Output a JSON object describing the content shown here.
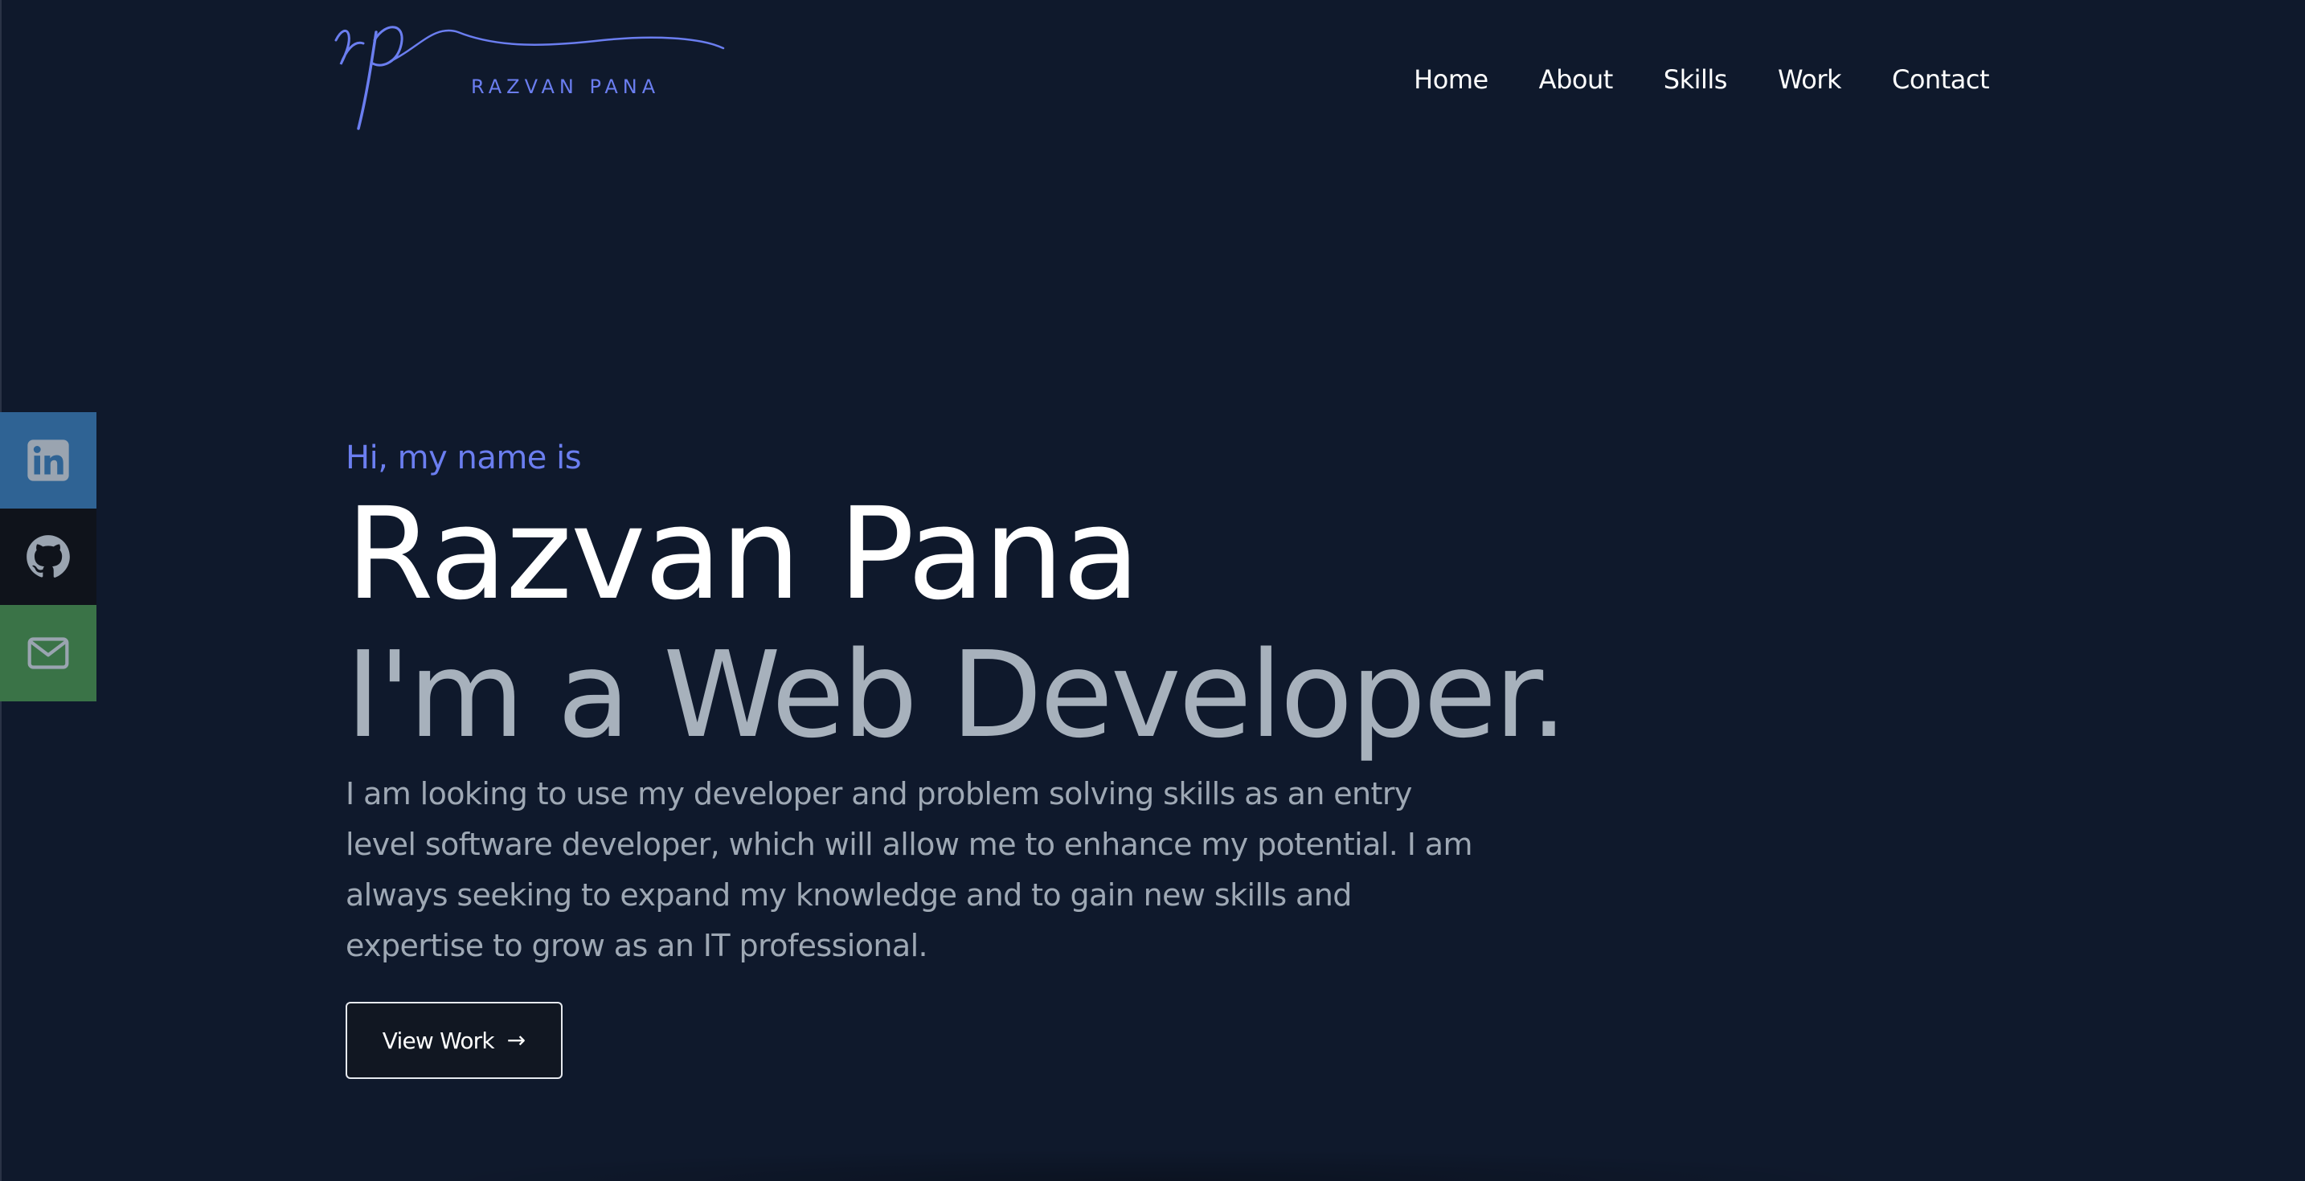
{
  "colors": {
    "background": "#0f192c",
    "accent": "#6b7ef0",
    "heading": "#ffffff",
    "subheading": "#a7b1bc",
    "body_text": "#9ea8b4",
    "linkedin": "#2f6394",
    "github": "#0f131b",
    "email": "#3a7347"
  },
  "header": {
    "logo_monogram": "rp",
    "logo_text": "RAZVAN PANA",
    "nav": [
      {
        "label": "Home"
      },
      {
        "label": "About"
      },
      {
        "label": "Skills"
      },
      {
        "label": "Work"
      },
      {
        "label": "Contact"
      }
    ]
  },
  "social": [
    {
      "name": "linkedin",
      "icon": "linkedin-icon"
    },
    {
      "name": "github",
      "icon": "github-icon"
    },
    {
      "name": "email",
      "icon": "mail-icon"
    }
  ],
  "hero": {
    "greeting": "Hi, my name is",
    "name": "Razvan Pana",
    "role": "I'm a Web Developer.",
    "intro": "I am looking to use my developer and problem solving skills as an entry level software developer, which will allow me to enhance my potential. I am always seeking to expand my knowledge and to gain new skills and expertise to grow as an IT professional.",
    "cta_label": "View Work",
    "cta_icon": "arrow-right-icon",
    "cta_arrow": "→"
  }
}
